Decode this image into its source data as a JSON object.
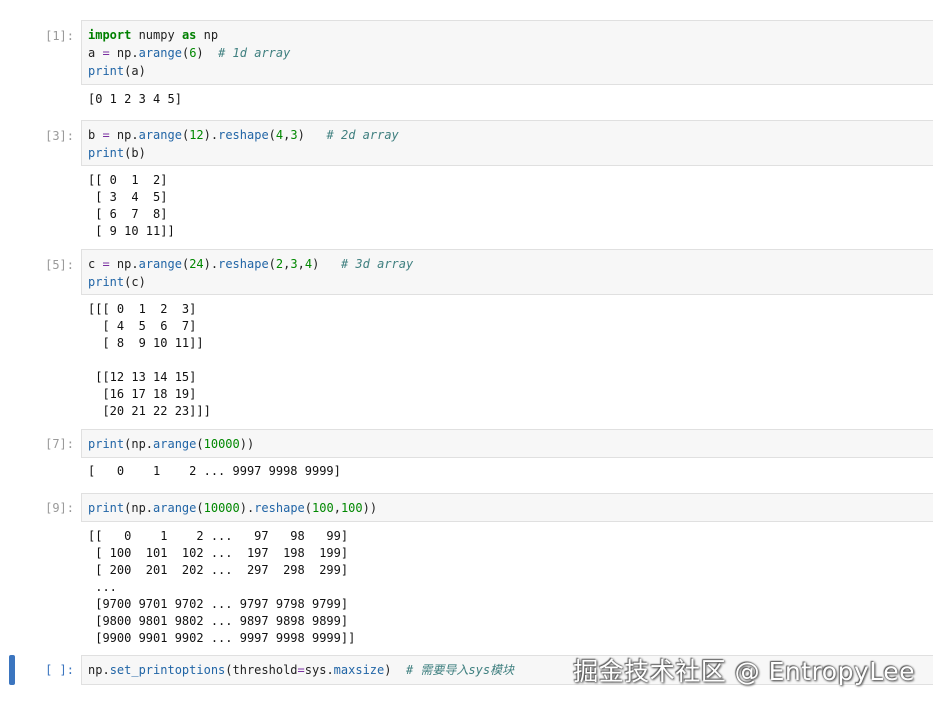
{
  "cells": [
    {
      "prompt": "[1]:",
      "code": [
        "import numpy as np",
        "a = np.arange(6)  # 1d array",
        "print(a)"
      ],
      "output": "[0 1 2 3 4 5]"
    },
    {
      "prompt": "[3]:",
      "code": [
        "b = np.arange(12).reshape(4,3)   # 2d array",
        "print(b)"
      ],
      "output": "[[ 0  1  2]\n [ 3  4  5]\n [ 6  7  8]\n [ 9 10 11]]"
    },
    {
      "prompt": "[5]:",
      "code": [
        "c = np.arange(24).reshape(2,3,4)   # 3d array",
        "print(c)"
      ],
      "output": "[[[ 0  1  2  3]\n  [ 4  5  6  7]\n  [ 8  9 10 11]]\n\n [[12 13 14 15]\n  [16 17 18 19]\n  [20 21 22 23]]]"
    },
    {
      "prompt": "[7]:",
      "code": [
        "print(np.arange(10000))"
      ],
      "output": "[   0    1    2 ... 9997 9998 9999]"
    },
    {
      "prompt": "[9]:",
      "code": [
        "print(np.arange(10000).reshape(100,100))"
      ],
      "output": "[[   0    1    2 ...   97   98   99]\n [ 100  101  102 ...  197  198  199]\n [ 200  201  202 ...  297  298  299]\n ...\n [9700 9701 9702 ... 9797 9798 9799]\n [9800 9801 9802 ... 9897 9898 9899]\n [9900 9901 9902 ... 9997 9998 9999]]"
    },
    {
      "prompt": "[ ]:",
      "code": [
        "np.set_printoptions(threshold=sys.maxsize)  # 需要导入sys模块"
      ],
      "output": ""
    }
  ],
  "watermark": "掘金技术社区 @ EntropyLee",
  "colors": {
    "keyword": "#008000",
    "function": "#2165a6",
    "number": "#008800",
    "operator": "#7a2fa0",
    "comment": "#408080",
    "active_prompt": "#3b75bf",
    "selection_bar": "#3b75bf",
    "input_background": "#f7f7f7"
  }
}
